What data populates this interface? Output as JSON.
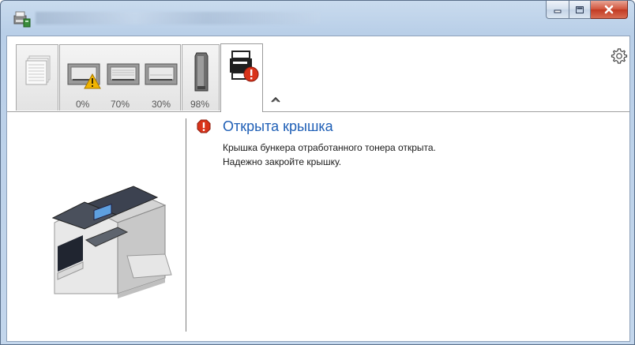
{
  "window": {
    "title": "",
    "caption_buttons": {
      "minimize": "minimize-icon",
      "maximize": "maximize-icon",
      "close": "close-icon"
    }
  },
  "tabs": [
    {
      "id": "paper",
      "icon": "paper-stack-icon",
      "label": ""
    },
    {
      "id": "trays",
      "icon": "paper-tray-icon",
      "levels": [
        "0%",
        "70%",
        "30%"
      ],
      "warning_on_first": true
    },
    {
      "id": "toner",
      "icon": "toner-cartridge-icon",
      "level": "98%"
    },
    {
      "id": "status",
      "icon": "printer-error-icon",
      "active": true
    }
  ],
  "toolbar": {
    "collapse_icon": "chevron-up-icon",
    "settings_icon": "gear-icon"
  },
  "status": {
    "icon": "error-icon",
    "title": "Открыта крышка",
    "message_line1": "Крышка бункера отработанного тонера открыта.",
    "message_line2": "Надежно закройте крышку."
  },
  "colors": {
    "accent": "#1f5fb6",
    "error": "#d9331a",
    "warning": "#f0b400"
  }
}
